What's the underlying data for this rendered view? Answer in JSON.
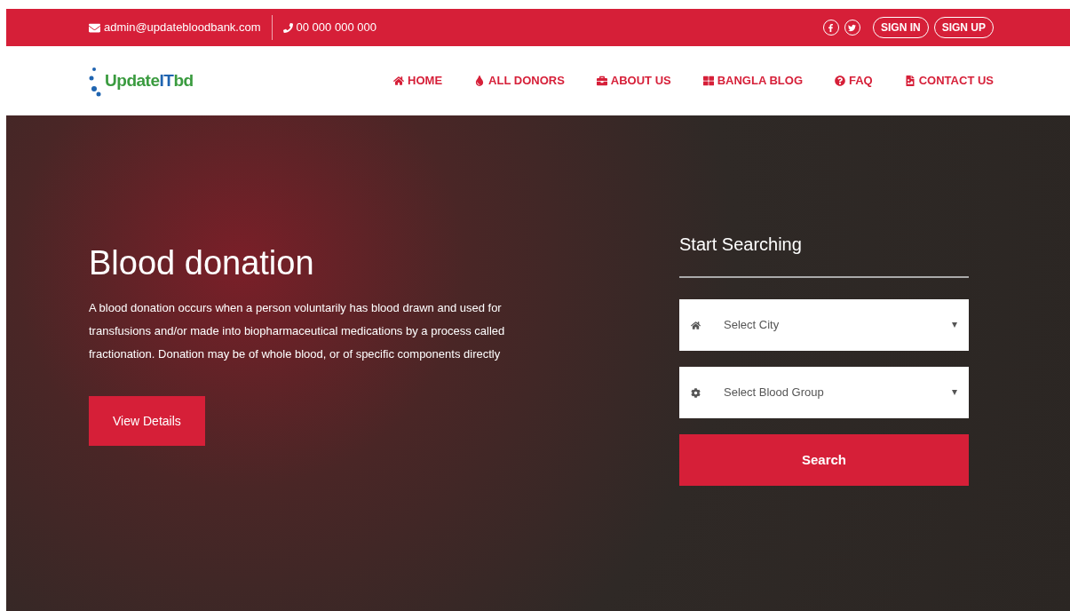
{
  "top_bar": {
    "email": "admin@updatebloodbank.com",
    "phone": "00 000 000 000",
    "buttons": [
      "SIGN IN",
      "SIGN UP"
    ]
  },
  "logo": {
    "parts": [
      {
        "text": "Update",
        "color": "#3a9b3f"
      },
      {
        "text": "IT",
        "color": "#1f64b0"
      },
      {
        "text": "bd",
        "color": "#3a9b3f"
      }
    ]
  },
  "nav": [
    "HOME",
    "ALL DONORS",
    "ABOUT US",
    "BANGLA BLOG",
    "FAQ",
    "CONTACT US"
  ],
  "hero": {
    "title": "Blood donation",
    "text": "A blood donation occurs when a person voluntarily has blood drawn and used for transfusions and/or made into biopharmaceutical medications by a process called fractionation. Donation may be of whole blood, or of specific components directly",
    "button": "View Details"
  },
  "search": {
    "title": "Start Searching",
    "selects": [
      {
        "placeholder": "Select City"
      },
      {
        "placeholder": "Select Blood Group"
      }
    ],
    "button": "Search"
  }
}
